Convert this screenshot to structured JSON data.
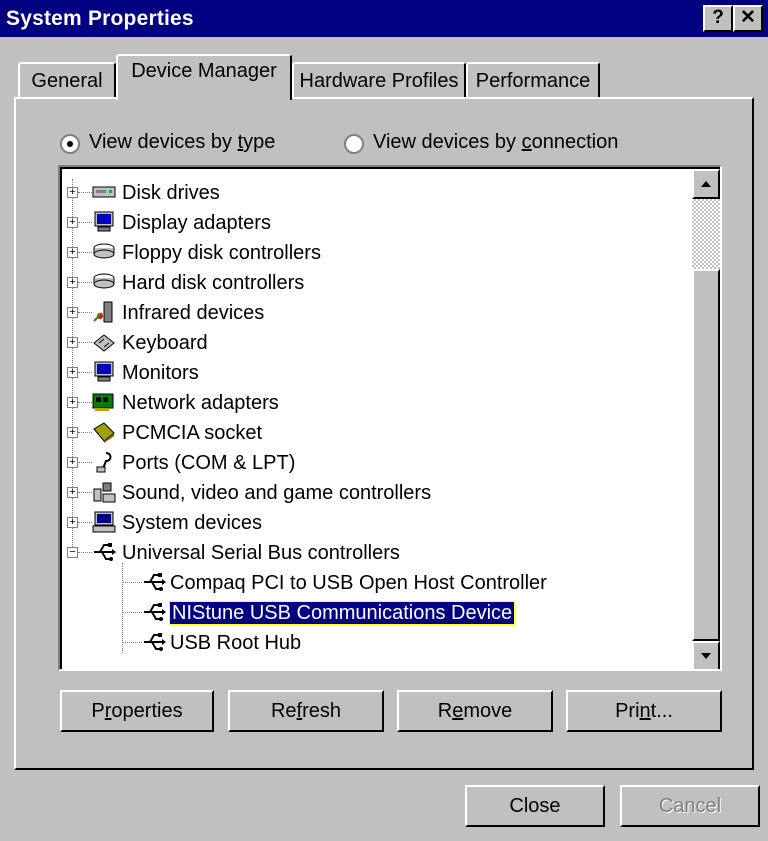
{
  "window": {
    "title": "System Properties",
    "help_button": "?",
    "close_button": "✕"
  },
  "tabs": [
    {
      "label": "General"
    },
    {
      "label": "Device Manager"
    },
    {
      "label": "Hardware Profiles"
    },
    {
      "label": "Performance"
    }
  ],
  "view_options": {
    "by_type": {
      "prefix": "View devices by ",
      "mnemonic": "t",
      "suffix": "ype",
      "selected": true
    },
    "by_connection": {
      "prefix": "View devices by ",
      "mnemonic": "c",
      "suffix": "onnection",
      "selected": false
    }
  },
  "devices": [
    {
      "label": "Disk drives",
      "icon": "disk-drive-icon"
    },
    {
      "label": "Display adapters",
      "icon": "monitor-icon"
    },
    {
      "label": "Floppy disk controllers",
      "icon": "disk-controller-icon"
    },
    {
      "label": "Hard disk controllers",
      "icon": "disk-controller-icon"
    },
    {
      "label": "Infrared devices",
      "icon": "infrared-icon"
    },
    {
      "label": "Keyboard",
      "icon": "keyboard-icon"
    },
    {
      "label": "Monitors",
      "icon": "monitor-icon"
    },
    {
      "label": "Network adapters",
      "icon": "network-adapter-icon"
    },
    {
      "label": "PCMCIA socket",
      "icon": "pcmcia-icon"
    },
    {
      "label": "Ports (COM & LPT)",
      "icon": "port-icon"
    },
    {
      "label": "Sound, video and game controllers",
      "icon": "sound-icon"
    },
    {
      "label": "System devices",
      "icon": "computer-icon"
    },
    {
      "label": "Universal Serial Bus controllers",
      "icon": "usb-icon",
      "expanded": true,
      "children": [
        {
          "label": "Compaq PCI to USB Open Host Controller",
          "icon": "usb-icon"
        },
        {
          "label": "NIStune USB Communications Device",
          "icon": "usb-icon",
          "selected": true
        },
        {
          "label": "USB Root Hub",
          "icon": "usb-icon"
        }
      ]
    }
  ],
  "buttons": {
    "properties": {
      "pre": "P",
      "mn": "r",
      "post": "operties"
    },
    "refresh": {
      "pre": "Re",
      "mn": "f",
      "post": "resh"
    },
    "remove": {
      "pre": "R",
      "mn": "e",
      "post": "move"
    },
    "print": {
      "pre": "Pri",
      "mn": "n",
      "post": "t..."
    },
    "close": "Close",
    "cancel": "Cancel"
  }
}
